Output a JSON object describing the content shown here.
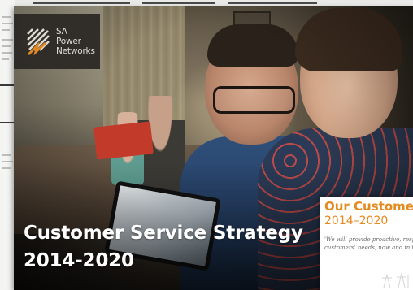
{
  "cover": {
    "logo": {
      "line1": "SA",
      "line2": "Power",
      "line3": "Networks",
      "icon": "sa-power-networks-logo-icon"
    },
    "headline": {
      "line1": "Customer Service Strategy",
      "line2": "2014-2020"
    },
    "photo": "family-with-tablet-photo"
  },
  "inset_page": {
    "title": "Our Customer",
    "years": "2014–2020",
    "quote_line1": "'We will provide proactive, responsi",
    "quote_line2": "customers' needs, now and in the f"
  },
  "colors": {
    "accent_orange": "#e58a1f",
    "logo_bg": "#2b2724",
    "headline_text": "#ffffff"
  }
}
